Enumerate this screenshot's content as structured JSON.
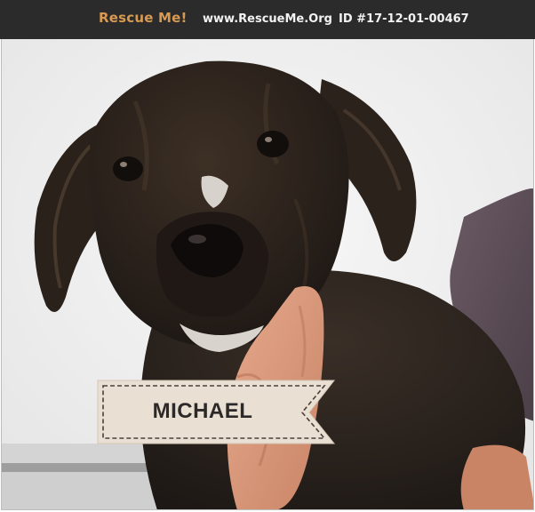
{
  "header": {
    "brand": "Rescue Me!",
    "site": "www.RescueMe.Org",
    "listing_id": "ID #17-12-01-00467"
  },
  "pet": {
    "name": "MICHAEL",
    "photo_subject": "puppy-photo"
  },
  "colors": {
    "header_bg": "#2b2b2b",
    "brand": "#d89a52",
    "header_text": "#f2f2f2",
    "tag_fill": "#e9dfd3",
    "tag_text": "#2c2a28"
  }
}
